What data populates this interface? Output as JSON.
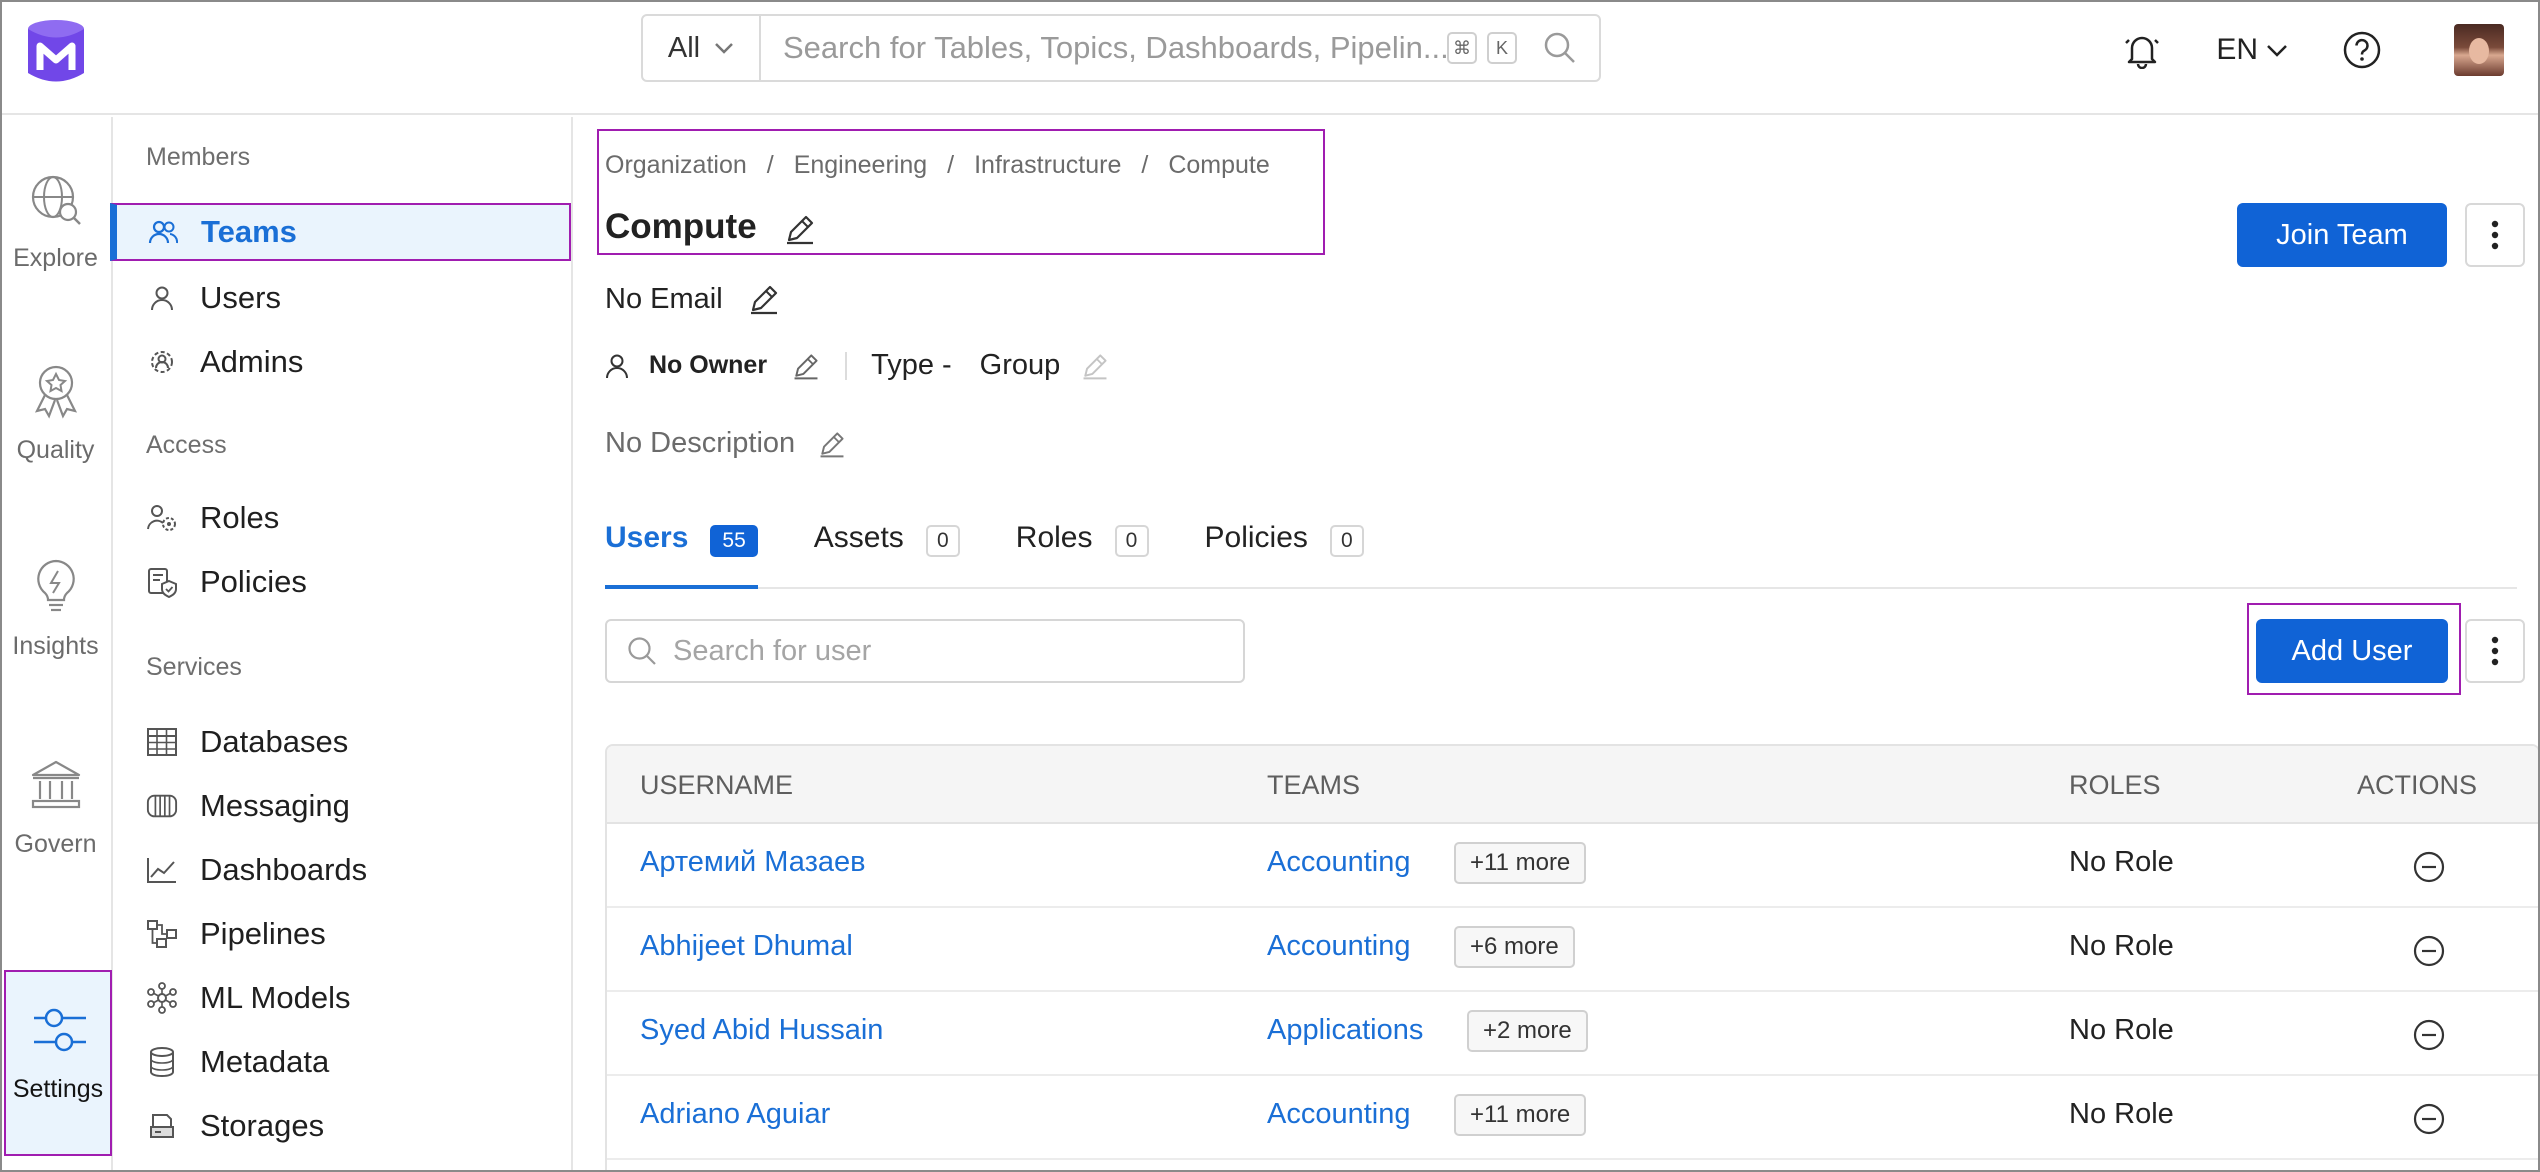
{
  "search": {
    "scope": "All",
    "placeholder": "Search for Tables, Topics, Dashboards, Pipelin...",
    "shortcut_cmd": "⌘",
    "shortcut_key": "K"
  },
  "header": {
    "language": "EN"
  },
  "icon_nav": [
    {
      "label": "Explore"
    },
    {
      "label": "Quality"
    },
    {
      "label": "Insights"
    },
    {
      "label": "Govern"
    },
    {
      "label": "Settings"
    }
  ],
  "sidebar": {
    "sections": {
      "members": "Members",
      "access": "Access",
      "services": "Services"
    },
    "items": {
      "teams": "Teams",
      "users": "Users",
      "admins": "Admins",
      "roles": "Roles",
      "policies": "Policies",
      "databases": "Databases",
      "messaging": "Messaging",
      "dashboards": "Dashboards",
      "pipelines": "Pipelines",
      "ml_models": "ML Models",
      "metadata": "Metadata",
      "storages": "Storages"
    }
  },
  "breadcrumb": [
    "Organization",
    "Engineering",
    "Infrastructure",
    "Compute"
  ],
  "team": {
    "name": "Compute",
    "email": "No Email",
    "owner": "No Owner",
    "type_label": "Type -",
    "type_value": "Group",
    "description": "No Description"
  },
  "actions": {
    "join": "Join Team",
    "add_user": "Add User"
  },
  "tabs": [
    {
      "label": "Users",
      "count": "55"
    },
    {
      "label": "Assets",
      "count": "0"
    },
    {
      "label": "Roles",
      "count": "0"
    },
    {
      "label": "Policies",
      "count": "0"
    }
  ],
  "user_search": {
    "placeholder": "Search for user"
  },
  "table": {
    "headers": [
      "USERNAME",
      "TEAMS",
      "ROLES",
      "ACTIONS"
    ],
    "rows": [
      {
        "username": "Артемий Мазаев",
        "team": "Accounting",
        "more": "+11 more",
        "role": "No Role"
      },
      {
        "username": "Abhijeet Dhumal",
        "team": "Accounting",
        "more": "+6 more",
        "role": "No Role"
      },
      {
        "username": "Syed Abid Hussain",
        "team": "Applications",
        "more": "+2 more",
        "role": "No Role"
      },
      {
        "username": "Adriano Aguiar",
        "team": "Accounting",
        "more": "+11 more",
        "role": "No Role"
      }
    ]
  },
  "colors": {
    "primary": "#1063d6",
    "link": "#1a6fd6",
    "highlight": "#a01db0",
    "active_bg": "#eaf4fd",
    "logo": "#7147e8"
  }
}
